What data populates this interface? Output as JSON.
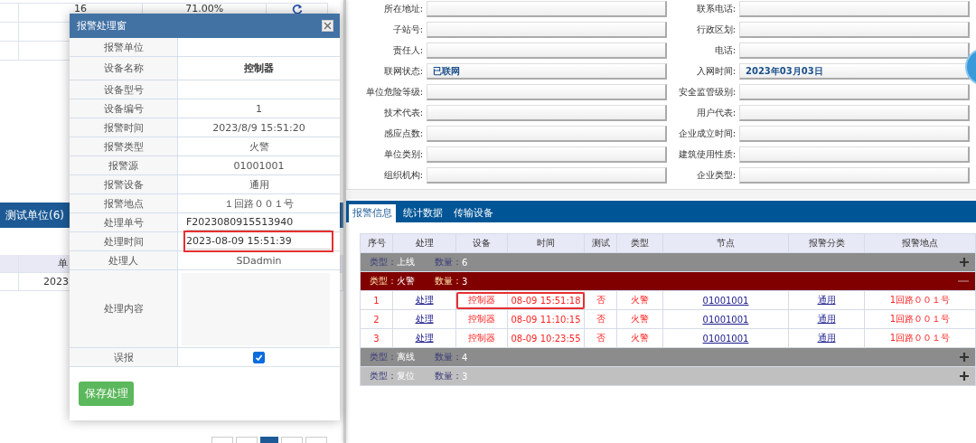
{
  "background_table": {
    "rows": [
      {
        "column_2": "16",
        "column_3": "71.00%"
      }
    ]
  },
  "unit_panel": {
    "title": "测试单位(6)",
    "table": {
      "header": {
        "column_2": "单"
      },
      "rows": [
        {
          "column_2": "2023"
        }
      ]
    }
  },
  "pager": [
    {
      "selected": false
    },
    {
      "selected": false
    },
    {
      "selected": true
    },
    {
      "selected": false
    },
    {
      "selected": false
    }
  ],
  "dialog": {
    "title": "报警处理窗",
    "rows": [
      {
        "label": "报警单位",
        "kind": "text"
      },
      {
        "label": "设备名称",
        "kind": "strong",
        "value": "控制器"
      },
      {
        "label": "设备型号",
        "kind": "text"
      },
      {
        "label": "设备编号",
        "kind": "text",
        "value": "1"
      },
      {
        "label": "报警时间",
        "kind": "text",
        "value": "2023/8/9 15:51:20"
      },
      {
        "label": "报警类型",
        "kind": "text",
        "value": "火警"
      },
      {
        "label": "报警源",
        "kind": "text",
        "value": "01001001"
      },
      {
        "label": "报警设备",
        "kind": "text",
        "value": "通用"
      },
      {
        "label": "报警地点",
        "kind": "text",
        "value": "１回路００１号"
      },
      {
        "label": "处理单号",
        "kind": "input",
        "value": "F2023080915513940",
        "highlighted": false
      },
      {
        "label": "处理时间",
        "kind": "input",
        "value": "2023-08-09 15:51:39",
        "highlighted": true
      },
      {
        "label": "处理人",
        "kind": "text",
        "value": "SDadmin"
      },
      {
        "label": "处理内容",
        "kind": "textarea"
      },
      {
        "label": "误报",
        "kind": "checkbox",
        "checked": true
      }
    ],
    "save_button": "保存处理"
  },
  "unit_form": {
    "fields": [
      {
        "label": "所在地址:"
      },
      {
        "label": "联系电话:"
      },
      {
        "label": "子站号:"
      },
      {
        "label": "行政区划:"
      },
      {
        "label": "责任人:"
      },
      {
        "label": "电话:"
      },
      {
        "label": "联网状态:",
        "value": "已联网"
      },
      {
        "label": "入网时间:",
        "value": "2023年03月03日"
      },
      {
        "label": "单位危险等级:"
      },
      {
        "label": "安全监管级别:"
      },
      {
        "label": "技术代表:"
      },
      {
        "label": "用户代表:"
      },
      {
        "label": "感应点数:"
      },
      {
        "label": "企业成立时间:"
      },
      {
        "label": "单位类别:"
      },
      {
        "label": "建筑使用性质:"
      },
      {
        "label": "组织机构:"
      },
      {
        "label": "企业类型:"
      }
    ]
  },
  "tabs": [
    {
      "label": "报警信息",
      "selected": true
    },
    {
      "label": "统计数据",
      "selected": false
    },
    {
      "label": "传输设备",
      "selected": false
    }
  ],
  "alarm_table": {
    "columns": [
      "序号",
      "处理",
      "设备",
      "时间",
      "测试",
      "类型",
      "节点",
      "报警分类",
      "报警地点"
    ],
    "groups": [
      {
        "type_label": "类型：",
        "type": "上线",
        "count_label": "数量：",
        "count": "6",
        "expanded": false,
        "color": "#8c8c8c"
      },
      {
        "type_label": "类型：",
        "type": "火警",
        "count_label": "数量：",
        "count": "3",
        "expanded": true,
        "color": "#800000",
        "rows": [
          {
            "cells": [
              "1",
              "处理",
              "控制器",
              "08-09 15:51:18",
              "否",
              "火警",
              "01001001",
              "通用",
              "1回路００１号"
            ],
            "highlighted": true
          },
          {
            "cells": [
              "2",
              "处理",
              "控制器",
              "08-09 11:10:15",
              "否",
              "火警",
              "01001001",
              "通用",
              "1回路００１号"
            ],
            "highlighted": false
          },
          {
            "cells": [
              "3",
              "处理",
              "控制器",
              "08-09 10:23:55",
              "否",
              "火警",
              "01001001",
              "通用",
              "1回路００１号"
            ],
            "highlighted": false
          }
        ]
      },
      {
        "type_label": "类型：",
        "type": "离线",
        "count_label": "数量：",
        "count": "4",
        "expanded": false,
        "color": "#8c8c8c"
      },
      {
        "type_label": "类型：",
        "type": "复位",
        "count_label": "数量：",
        "count": "3",
        "expanded": false,
        "color": "#c0c0c0"
      }
    ]
  }
}
